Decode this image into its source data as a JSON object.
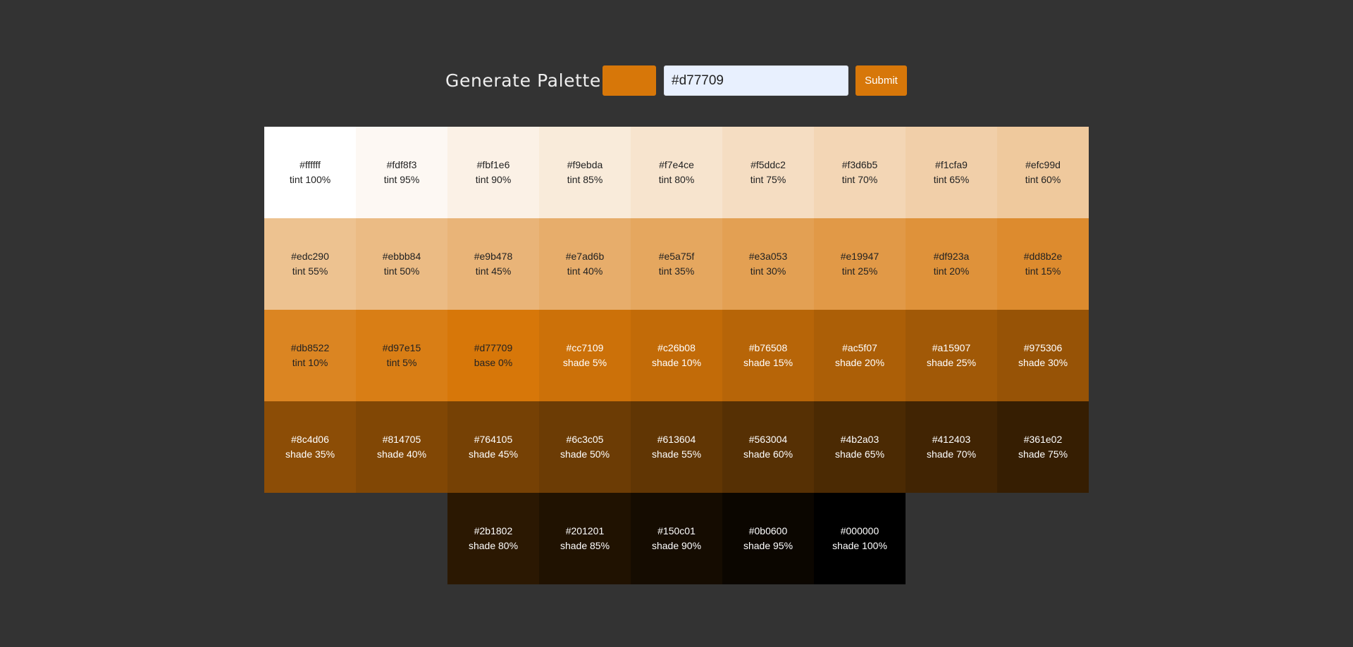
{
  "header": {
    "title": "Generate Palette",
    "swatch_color": "#d77709",
    "input_value": "#d77709",
    "submit_label": "Submit",
    "submit_color": "#d77709"
  },
  "palette": [
    {
      "hex": "#ffffff",
      "label": "tint 100%",
      "text_color": "#222222"
    },
    {
      "hex": "#fdf8f3",
      "label": "tint 95%",
      "text_color": "#222222"
    },
    {
      "hex": "#fbf1e6",
      "label": "tint 90%",
      "text_color": "#222222"
    },
    {
      "hex": "#f9ebda",
      "label": "tint 85%",
      "text_color": "#222222"
    },
    {
      "hex": "#f7e4ce",
      "label": "tint 80%",
      "text_color": "#222222"
    },
    {
      "hex": "#f5ddc2",
      "label": "tint 75%",
      "text_color": "#222222"
    },
    {
      "hex": "#f3d6b5",
      "label": "tint 70%",
      "text_color": "#222222"
    },
    {
      "hex": "#f1cfa9",
      "label": "tint 65%",
      "text_color": "#222222"
    },
    {
      "hex": "#efc99d",
      "label": "tint 60%",
      "text_color": "#222222"
    },
    {
      "hex": "#edc290",
      "label": "tint 55%",
      "text_color": "#222222"
    },
    {
      "hex": "#ebbb84",
      "label": "tint 50%",
      "text_color": "#222222"
    },
    {
      "hex": "#e9b478",
      "label": "tint 45%",
      "text_color": "#222222"
    },
    {
      "hex": "#e7ad6b",
      "label": "tint 40%",
      "text_color": "#222222"
    },
    {
      "hex": "#e5a75f",
      "label": "tint 35%",
      "text_color": "#222222"
    },
    {
      "hex": "#e3a053",
      "label": "tint 30%",
      "text_color": "#222222"
    },
    {
      "hex": "#e19947",
      "label": "tint 25%",
      "text_color": "#222222"
    },
    {
      "hex": "#df923a",
      "label": "tint 20%",
      "text_color": "#222222"
    },
    {
      "hex": "#dd8b2e",
      "label": "tint 15%",
      "text_color": "#222222"
    },
    {
      "hex": "#db8522",
      "label": "tint 10%",
      "text_color": "#222222"
    },
    {
      "hex": "#d97e15",
      "label": "tint 5%",
      "text_color": "#222222"
    },
    {
      "hex": "#d77709",
      "label": "base 0%",
      "text_color": "#222222"
    },
    {
      "hex": "#cc7109",
      "label": "shade 5%",
      "text_color": "#ffffff"
    },
    {
      "hex": "#c26b08",
      "label": "shade 10%",
      "text_color": "#ffffff"
    },
    {
      "hex": "#b76508",
      "label": "shade 15%",
      "text_color": "#ffffff"
    },
    {
      "hex": "#ac5f07",
      "label": "shade 20%",
      "text_color": "#ffffff"
    },
    {
      "hex": "#a15907",
      "label": "shade 25%",
      "text_color": "#ffffff"
    },
    {
      "hex": "#975306",
      "label": "shade 30%",
      "text_color": "#ffffff"
    },
    {
      "hex": "#8c4d06",
      "label": "shade 35%",
      "text_color": "#ffffff"
    },
    {
      "hex": "#814705",
      "label": "shade 40%",
      "text_color": "#ffffff"
    },
    {
      "hex": "#764105",
      "label": "shade 45%",
      "text_color": "#ffffff"
    },
    {
      "hex": "#6c3c05",
      "label": "shade 50%",
      "text_color": "#ffffff"
    },
    {
      "hex": "#613604",
      "label": "shade 55%",
      "text_color": "#ffffff"
    },
    {
      "hex": "#563004",
      "label": "shade 60%",
      "text_color": "#ffffff"
    },
    {
      "hex": "#4b2a03",
      "label": "shade 65%",
      "text_color": "#ffffff"
    },
    {
      "hex": "#412403",
      "label": "shade 70%",
      "text_color": "#ffffff"
    },
    {
      "hex": "#361e02",
      "label": "shade 75%",
      "text_color": "#ffffff"
    },
    {
      "hex": "#2b1802",
      "label": "shade 80%",
      "text_color": "#ffffff"
    },
    {
      "hex": "#201201",
      "label": "shade 85%",
      "text_color": "#ffffff"
    },
    {
      "hex": "#150c01",
      "label": "shade 90%",
      "text_color": "#ffffff"
    },
    {
      "hex": "#0b0600",
      "label": "shade 95%",
      "text_color": "#ffffff"
    },
    {
      "hex": "#000000",
      "label": "shade 100%",
      "text_color": "#ffffff"
    }
  ]
}
